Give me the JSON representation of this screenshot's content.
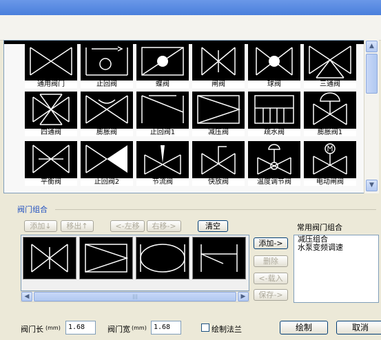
{
  "palette": {
    "rows": [
      [
        "通用阀门",
        "止回阀",
        "蝶阀",
        "闸阀",
        "球阀",
        "三通阀"
      ],
      [
        "四通阀",
        "膨胀阀",
        "止回阀1",
        "减压阀",
        "疏水阀",
        "膨胀阀1"
      ],
      [
        "平衡阀",
        "止回阀2",
        "节流阀",
        "快放阀",
        "温度调节阀",
        "电动闸阀"
      ]
    ],
    "scroll_up_icon": "arrow-up-icon",
    "scroll_down_icon": "arrow-down-icon"
  },
  "group": {
    "title": "阀门组合",
    "add_label": "添加↓",
    "remove_label": "移出↑",
    "move_left_label": "<-左移",
    "move_right_label": "右移->",
    "clear_label": "清空"
  },
  "common": {
    "title": "常用阀门组合",
    "items": [
      "减压组合",
      "水泵变频调速"
    ],
    "add_label": "添加->",
    "delete_label": "删除",
    "load_label": "<-载入",
    "save_label": "保存->"
  },
  "bottom": {
    "length_label": "阀门长",
    "length_unit": "(mm)",
    "length_value": "1.68",
    "width_label": "阀门宽",
    "width_unit": "(mm)",
    "width_value": "1.68",
    "draw_flange_label": "绘制法兰",
    "draw_flange_checked": false,
    "draw_label": "绘制",
    "cancel_label": "取消"
  }
}
